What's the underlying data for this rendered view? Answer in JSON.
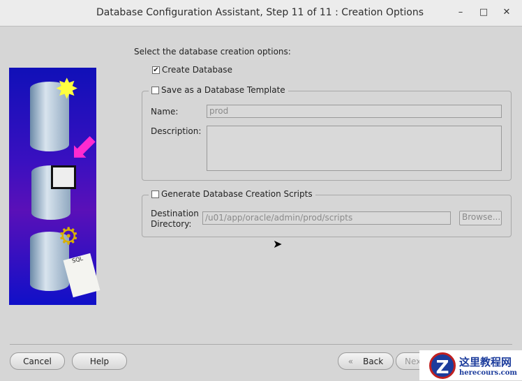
{
  "window": {
    "title": "Database Configuration Assistant, Step 11 of 11 : Creation Options",
    "minimize": "–",
    "maximize": "□",
    "close": "✕"
  },
  "prompt": "Select the database creation options:",
  "create_database": {
    "label": "Create Database",
    "checked": true
  },
  "template": {
    "label": "Save as a Database Template",
    "checked": false,
    "name_label": "Name:",
    "name_value": "prod",
    "description_label": "Description:",
    "description_value": ""
  },
  "scripts": {
    "label": "Generate Database Creation Scripts",
    "checked": false,
    "dest_label_1": "Destination",
    "dest_label_2": "Directory:",
    "dest_value": "/u01/app/oracle/admin/prod/scripts",
    "browse": "Browse..."
  },
  "buttons": {
    "cancel": "Cancel",
    "help": "Help",
    "back": "Back",
    "next": "Next"
  },
  "watermark": {
    "text": "这里教程网",
    "url": "herecours.com"
  }
}
